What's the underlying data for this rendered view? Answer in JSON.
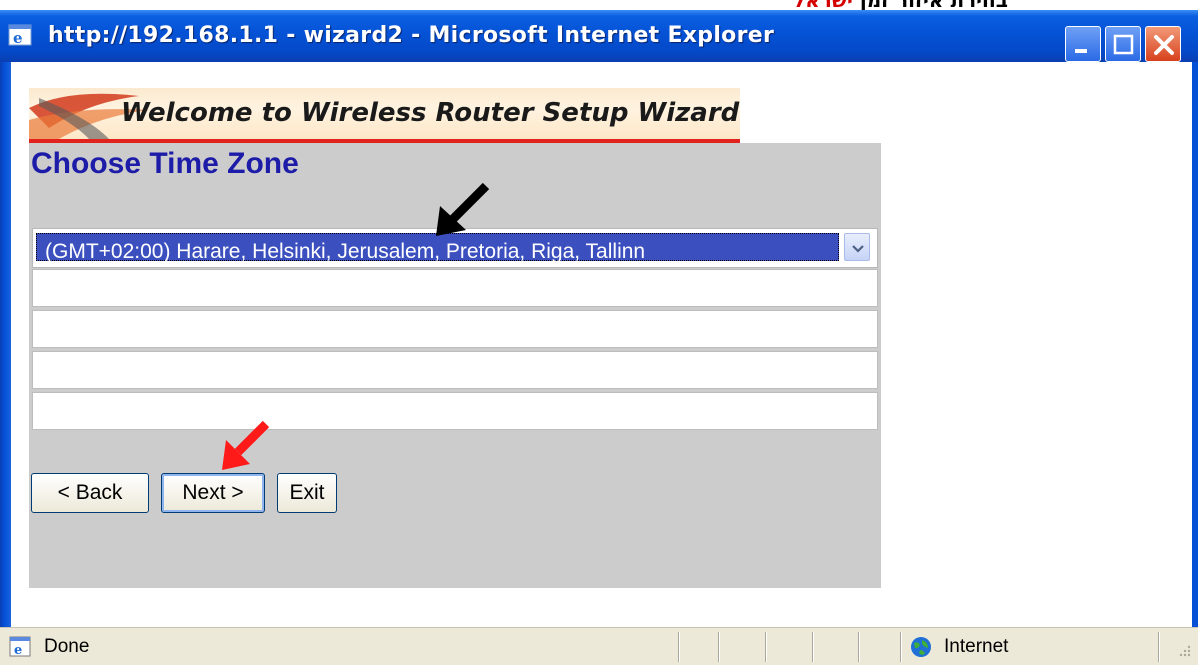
{
  "header_note": {
    "text_plain": "בחירת איזור זמן ",
    "text_red": "ישראל"
  },
  "window": {
    "title": "http://192.168.1.1 - wizard2 - Microsoft Internet Explorer",
    "controls": {
      "minimize": "minimize",
      "maximize": "maximize",
      "close": "close"
    }
  },
  "banner": {
    "text": "Welcome to Wireless Router Setup Wizard"
  },
  "page": {
    "title": "Choose Time Zone",
    "timezone": {
      "selected": "(GMT+02:00) Harare, Helsinki, Jerusalem, Pretoria, Riga, Tallinn"
    },
    "buttons": {
      "back": "< Back",
      "next": "Next >",
      "exit": "Exit"
    }
  },
  "annotations": {
    "arrow_colors": [
      "#000000",
      "#ff1a1a"
    ]
  },
  "statusbar": {
    "status": "Done",
    "zone": "Internet"
  },
  "colors": {
    "title_blue": "#1c1ca8",
    "selection": "#3b4fbf",
    "panel": "#cccccc",
    "accent_red": "#e0231c"
  }
}
